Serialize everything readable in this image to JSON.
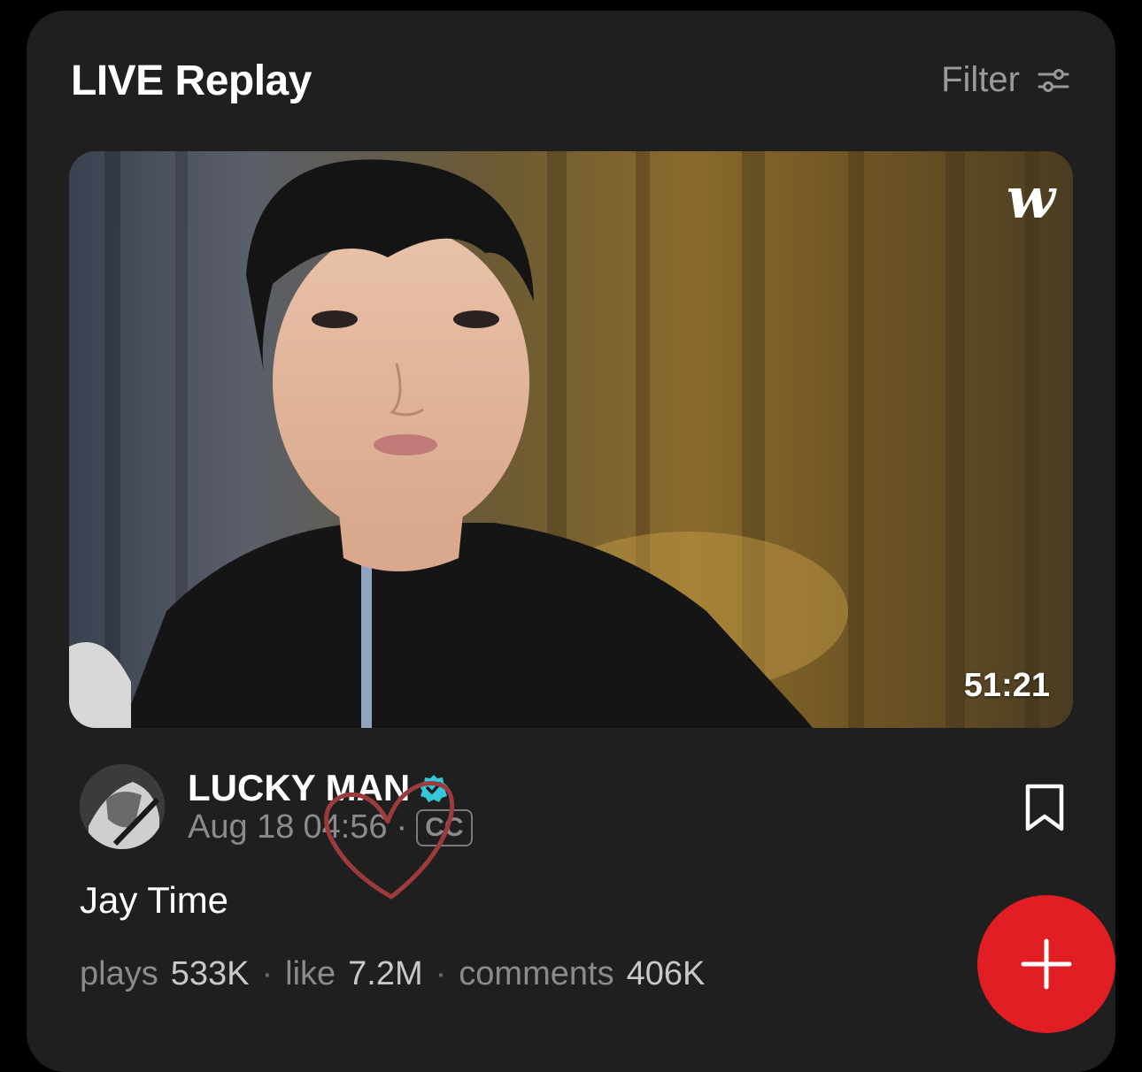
{
  "section": {
    "title": "LIVE Replay",
    "filter_label": "Filter",
    "filter_icon": "sliders-icon"
  },
  "video": {
    "brand_logo": "w",
    "duration": "51:21"
  },
  "channel": {
    "name": "LUCKY MAN",
    "verified_icon": "verified-badge-icon",
    "date": "Aug 18",
    "time": "04:56",
    "separator": "·",
    "cc_label": "CC"
  },
  "post": {
    "title": "Jay Time"
  },
  "stats": {
    "plays_label": "plays",
    "plays_value": "533K",
    "like_label": "like",
    "like_value": "7.2M",
    "comments_label": "comments",
    "comments_value": "406K",
    "separator": "·"
  },
  "actions": {
    "bookmark_icon": "bookmark-icon",
    "fab_icon": "plus-icon"
  },
  "colors": {
    "background": "#000000",
    "card": "#1f1f1f",
    "accent_red": "#e01e24",
    "verified": "#35c7d9",
    "doodle": "#9b3b3b"
  }
}
